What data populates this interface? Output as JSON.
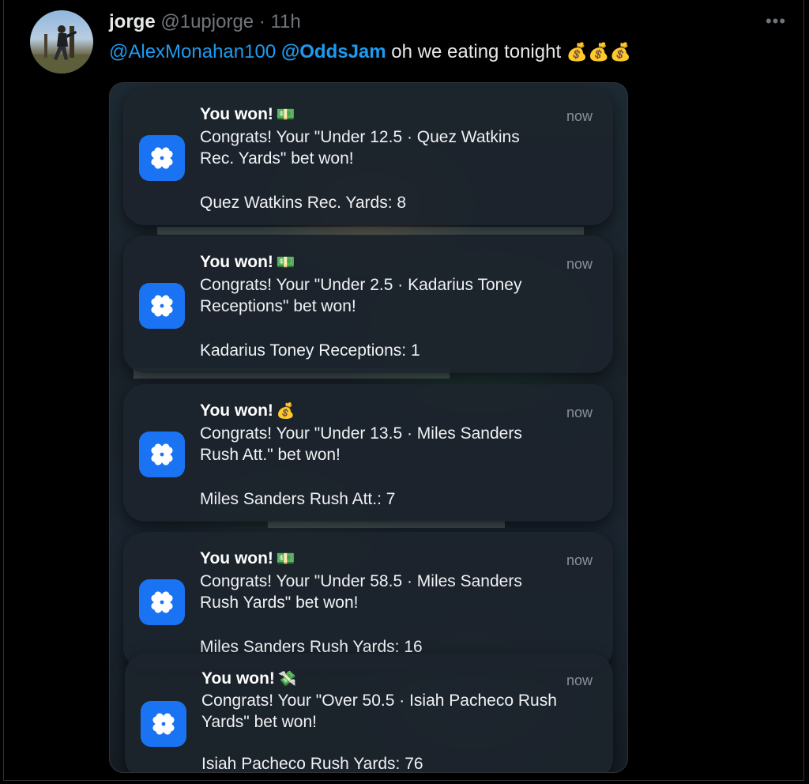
{
  "tweet": {
    "display_name": "jorge",
    "handle": "@1upjorge",
    "separator": "·",
    "time": "11h",
    "more_label": "•••",
    "mention_1": "@AlexMonahan100",
    "mention_2": "@OddsJam",
    "text": "oh we eating tonight",
    "trailing_emoji": "💰💰💰"
  },
  "notifications": [
    {
      "title": "You won!",
      "emoji": "💵",
      "time": "now",
      "body_line1": "Congrats! Your \"Under 12.5 · Quez Watkins",
      "body_line2": "Rec. Yards\" bet won!",
      "result": "Quez Watkins Rec. Yards: 8"
    },
    {
      "title": "You won!",
      "emoji": "💵",
      "time": "now",
      "body_line1": "Congrats! Your \"Under 2.5 · Kadarius Toney",
      "body_line2": "Receptions\" bet won!",
      "result": "Kadarius Toney Receptions: 1"
    },
    {
      "title": "You won!",
      "emoji": "💰",
      "time": "now",
      "body_line1": "Congrats! Your \"Under 13.5 · Miles Sanders",
      "body_line2": "Rush Att.\" bet won!",
      "result": "Miles Sanders Rush Att.: 7"
    },
    {
      "title": "You won!",
      "emoji": "💵",
      "time": "now",
      "body_line1": "Congrats! Your \"Under 58.5 · Miles Sanders",
      "body_line2": "Rush Yards\" bet won!",
      "result": "Miles Sanders Rush Yards: 16"
    },
    {
      "title": "You won!",
      "emoji": "💸",
      "time": "now",
      "body_line1": "Congrats! Your \"Over 50.5 · Isiah Pacheco Rush",
      "body_line2": "Yards\" bet won!",
      "result": "Isiah Pacheco Rush Yards: 76"
    }
  ],
  "colors": {
    "link": "#1d9bf0",
    "app_icon": "#1a73f2",
    "background": "#000000"
  },
  "icons": {
    "avatar": "user-avatar-photo",
    "app": "clover-icon",
    "more": "more-horizontal-icon"
  }
}
